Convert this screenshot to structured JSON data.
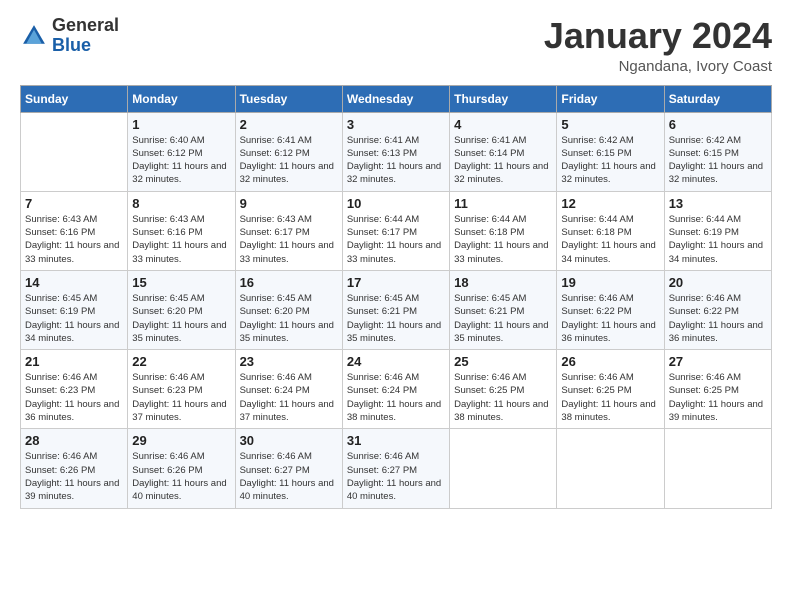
{
  "logo": {
    "general": "General",
    "blue": "Blue"
  },
  "header": {
    "month": "January 2024",
    "location": "Ngandana, Ivory Coast"
  },
  "days_of_week": [
    "Sunday",
    "Monday",
    "Tuesday",
    "Wednesday",
    "Thursday",
    "Friday",
    "Saturday"
  ],
  "weeks": [
    [
      {
        "day": "",
        "sunrise": "",
        "sunset": "",
        "daylight": ""
      },
      {
        "day": "1",
        "sunrise": "Sunrise: 6:40 AM",
        "sunset": "Sunset: 6:12 PM",
        "daylight": "Daylight: 11 hours and 32 minutes."
      },
      {
        "day": "2",
        "sunrise": "Sunrise: 6:41 AM",
        "sunset": "Sunset: 6:12 PM",
        "daylight": "Daylight: 11 hours and 32 minutes."
      },
      {
        "day": "3",
        "sunrise": "Sunrise: 6:41 AM",
        "sunset": "Sunset: 6:13 PM",
        "daylight": "Daylight: 11 hours and 32 minutes."
      },
      {
        "day": "4",
        "sunrise": "Sunrise: 6:41 AM",
        "sunset": "Sunset: 6:14 PM",
        "daylight": "Daylight: 11 hours and 32 minutes."
      },
      {
        "day": "5",
        "sunrise": "Sunrise: 6:42 AM",
        "sunset": "Sunset: 6:15 PM",
        "daylight": "Daylight: 11 hours and 32 minutes."
      },
      {
        "day": "6",
        "sunrise": "Sunrise: 6:42 AM",
        "sunset": "Sunset: 6:15 PM",
        "daylight": "Daylight: 11 hours and 32 minutes."
      }
    ],
    [
      {
        "day": "7",
        "sunrise": "Sunrise: 6:43 AM",
        "sunset": "Sunset: 6:16 PM",
        "daylight": "Daylight: 11 hours and 33 minutes."
      },
      {
        "day": "8",
        "sunrise": "Sunrise: 6:43 AM",
        "sunset": "Sunset: 6:16 PM",
        "daylight": "Daylight: 11 hours and 33 minutes."
      },
      {
        "day": "9",
        "sunrise": "Sunrise: 6:43 AM",
        "sunset": "Sunset: 6:17 PM",
        "daylight": "Daylight: 11 hours and 33 minutes."
      },
      {
        "day": "10",
        "sunrise": "Sunrise: 6:44 AM",
        "sunset": "Sunset: 6:17 PM",
        "daylight": "Daylight: 11 hours and 33 minutes."
      },
      {
        "day": "11",
        "sunrise": "Sunrise: 6:44 AM",
        "sunset": "Sunset: 6:18 PM",
        "daylight": "Daylight: 11 hours and 33 minutes."
      },
      {
        "day": "12",
        "sunrise": "Sunrise: 6:44 AM",
        "sunset": "Sunset: 6:18 PM",
        "daylight": "Daylight: 11 hours and 34 minutes."
      },
      {
        "day": "13",
        "sunrise": "Sunrise: 6:44 AM",
        "sunset": "Sunset: 6:19 PM",
        "daylight": "Daylight: 11 hours and 34 minutes."
      }
    ],
    [
      {
        "day": "14",
        "sunrise": "Sunrise: 6:45 AM",
        "sunset": "Sunset: 6:19 PM",
        "daylight": "Daylight: 11 hours and 34 minutes."
      },
      {
        "day": "15",
        "sunrise": "Sunrise: 6:45 AM",
        "sunset": "Sunset: 6:20 PM",
        "daylight": "Daylight: 11 hours and 35 minutes."
      },
      {
        "day": "16",
        "sunrise": "Sunrise: 6:45 AM",
        "sunset": "Sunset: 6:20 PM",
        "daylight": "Daylight: 11 hours and 35 minutes."
      },
      {
        "day": "17",
        "sunrise": "Sunrise: 6:45 AM",
        "sunset": "Sunset: 6:21 PM",
        "daylight": "Daylight: 11 hours and 35 minutes."
      },
      {
        "day": "18",
        "sunrise": "Sunrise: 6:45 AM",
        "sunset": "Sunset: 6:21 PM",
        "daylight": "Daylight: 11 hours and 35 minutes."
      },
      {
        "day": "19",
        "sunrise": "Sunrise: 6:46 AM",
        "sunset": "Sunset: 6:22 PM",
        "daylight": "Daylight: 11 hours and 36 minutes."
      },
      {
        "day": "20",
        "sunrise": "Sunrise: 6:46 AM",
        "sunset": "Sunset: 6:22 PM",
        "daylight": "Daylight: 11 hours and 36 minutes."
      }
    ],
    [
      {
        "day": "21",
        "sunrise": "Sunrise: 6:46 AM",
        "sunset": "Sunset: 6:23 PM",
        "daylight": "Daylight: 11 hours and 36 minutes."
      },
      {
        "day": "22",
        "sunrise": "Sunrise: 6:46 AM",
        "sunset": "Sunset: 6:23 PM",
        "daylight": "Daylight: 11 hours and 37 minutes."
      },
      {
        "day": "23",
        "sunrise": "Sunrise: 6:46 AM",
        "sunset": "Sunset: 6:24 PM",
        "daylight": "Daylight: 11 hours and 37 minutes."
      },
      {
        "day": "24",
        "sunrise": "Sunrise: 6:46 AM",
        "sunset": "Sunset: 6:24 PM",
        "daylight": "Daylight: 11 hours and 38 minutes."
      },
      {
        "day": "25",
        "sunrise": "Sunrise: 6:46 AM",
        "sunset": "Sunset: 6:25 PM",
        "daylight": "Daylight: 11 hours and 38 minutes."
      },
      {
        "day": "26",
        "sunrise": "Sunrise: 6:46 AM",
        "sunset": "Sunset: 6:25 PM",
        "daylight": "Daylight: 11 hours and 38 minutes."
      },
      {
        "day": "27",
        "sunrise": "Sunrise: 6:46 AM",
        "sunset": "Sunset: 6:25 PM",
        "daylight": "Daylight: 11 hours and 39 minutes."
      }
    ],
    [
      {
        "day": "28",
        "sunrise": "Sunrise: 6:46 AM",
        "sunset": "Sunset: 6:26 PM",
        "daylight": "Daylight: 11 hours and 39 minutes."
      },
      {
        "day": "29",
        "sunrise": "Sunrise: 6:46 AM",
        "sunset": "Sunset: 6:26 PM",
        "daylight": "Daylight: 11 hours and 40 minutes."
      },
      {
        "day": "30",
        "sunrise": "Sunrise: 6:46 AM",
        "sunset": "Sunset: 6:27 PM",
        "daylight": "Daylight: 11 hours and 40 minutes."
      },
      {
        "day": "31",
        "sunrise": "Sunrise: 6:46 AM",
        "sunset": "Sunset: 6:27 PM",
        "daylight": "Daylight: 11 hours and 40 minutes."
      },
      {
        "day": "",
        "sunrise": "",
        "sunset": "",
        "daylight": ""
      },
      {
        "day": "",
        "sunrise": "",
        "sunset": "",
        "daylight": ""
      },
      {
        "day": "",
        "sunrise": "",
        "sunset": "",
        "daylight": ""
      }
    ]
  ]
}
